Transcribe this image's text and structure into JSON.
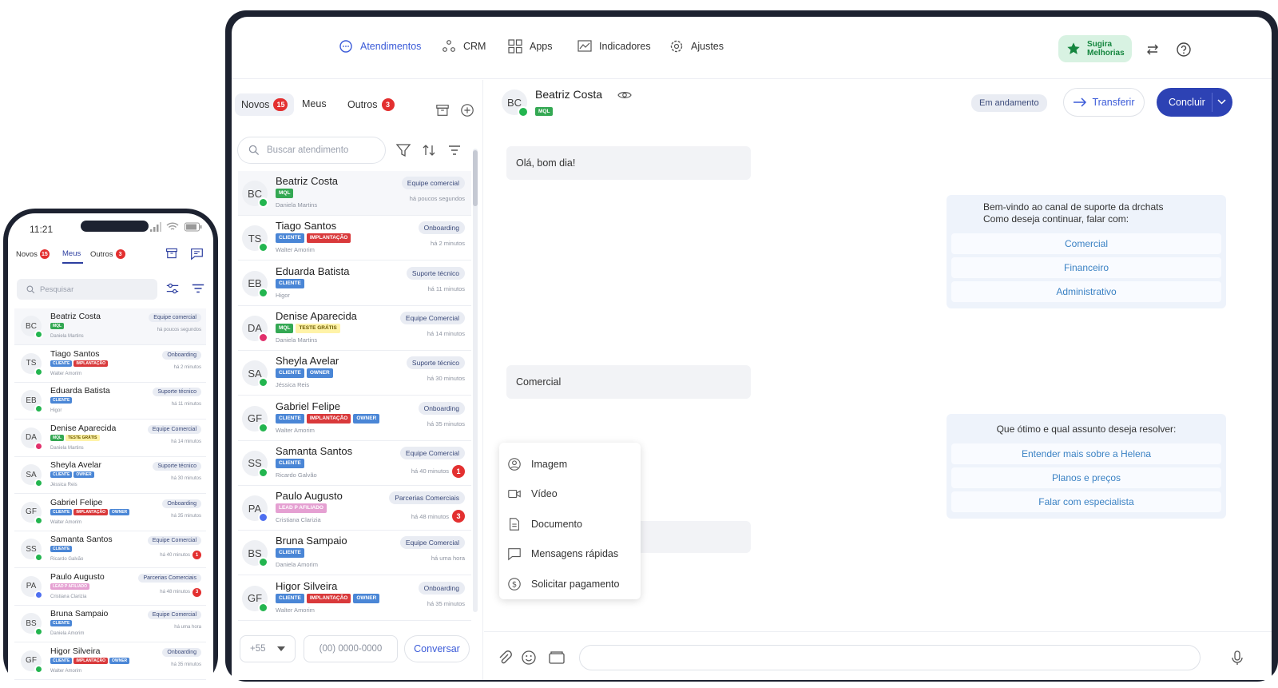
{
  "desktop": {
    "nav": [
      {
        "label": "Atendimentos",
        "icon": "chat-bubble-icon"
      },
      {
        "label": "CRM",
        "icon": "crm-nodes-icon"
      },
      {
        "label": "Apps",
        "icon": "apps-grid-icon"
      },
      {
        "label": "Indicadores",
        "icon": "chart-icon"
      },
      {
        "label": "Ajustes",
        "icon": "gear-icon"
      }
    ],
    "suggest_label": "Sugira Melhorias",
    "tabs": {
      "novos": "Novos",
      "novos_count": "15",
      "meus": "Meus",
      "outros": "Outros",
      "outros_count": "3"
    },
    "search_placeholder": "Buscar atendimento",
    "conversations": [
      {
        "initials": "BC",
        "name": "Beatriz Costa",
        "tags": [
          {
            "t": "MQL",
            "c": "mql"
          }
        ],
        "agent": "Daniela Martins",
        "team": "Equipe comercial",
        "time": "há poucos segundos",
        "badge": "",
        "channel": "whatsapp"
      },
      {
        "initials": "TS",
        "name": "Tiago Santos",
        "tags": [
          {
            "t": "CLIENTE",
            "c": "cliente"
          },
          {
            "t": "IMPLANTAÇÃO",
            "c": "impl"
          }
        ],
        "agent": "Walter Amorim",
        "team": "Onboarding",
        "time": "há 2 minutos",
        "badge": "",
        "channel": "whatsapp"
      },
      {
        "initials": "EB",
        "name": "Eduarda Batista",
        "tags": [
          {
            "t": "CLIENTE",
            "c": "cliente"
          }
        ],
        "agent": "Higor",
        "team": "Suporte técnico",
        "time": "há 11 minutos",
        "badge": "",
        "channel": "whatsapp"
      },
      {
        "initials": "DA",
        "name": "Denise Aparecida",
        "tags": [
          {
            "t": "MQL",
            "c": "mql"
          },
          {
            "t": "TESTE GRÁTIS",
            "c": "teste"
          }
        ],
        "agent": "Daniela Martins",
        "team": "Equipe Comercial",
        "time": "há 14 minutos",
        "badge": "",
        "channel": "instagram"
      },
      {
        "initials": "SA",
        "name": "Sheyla Avelar",
        "tags": [
          {
            "t": "CLIENTE",
            "c": "cliente"
          },
          {
            "t": "OWNER",
            "c": "owner"
          }
        ],
        "agent": "Jéssica Reis",
        "team": "Suporte técnico",
        "time": "há 30 minutos",
        "badge": "",
        "channel": "whatsapp"
      },
      {
        "initials": "GF",
        "name": "Gabriel Felipe",
        "tags": [
          {
            "t": "CLIENTE",
            "c": "cliente"
          },
          {
            "t": "IMPLANTAÇÃO",
            "c": "impl"
          },
          {
            "t": "OWNER",
            "c": "owner"
          }
        ],
        "agent": "Walter Amorim",
        "team": "Onboarding",
        "time": "há 35 minutos",
        "badge": "",
        "channel": "whatsapp"
      },
      {
        "initials": "SS",
        "name": "Samanta Santos",
        "tags": [
          {
            "t": "CLIENTE",
            "c": "cliente"
          }
        ],
        "agent": "Ricardo Galvão",
        "team": "Equipe Comercial",
        "time": "há 40 minutos",
        "badge": "1",
        "channel": "whatsapp"
      },
      {
        "initials": "PA",
        "name": "Paulo Augusto",
        "tags": [
          {
            "t": "LEAD P AFILIADO",
            "c": "lead"
          }
        ],
        "agent": "Cristiana Clarizia",
        "team": "Parcerias Comerciais",
        "time": "há 48 minutos",
        "badge": "3",
        "channel": "messenger"
      },
      {
        "initials": "BS",
        "name": "Bruna Sampaio",
        "tags": [
          {
            "t": "CLIENTE",
            "c": "cliente"
          }
        ],
        "agent": "Daniela Amorim",
        "team": "Equipe Comercial",
        "time": "há uma hora",
        "badge": "",
        "channel": "whatsapp"
      },
      {
        "initials": "GF",
        "name": "Higor Silveira",
        "tags": [
          {
            "t": "CLIENTE",
            "c": "cliente"
          },
          {
            "t": "IMPLANTAÇÃO",
            "c": "impl"
          },
          {
            "t": "OWNER",
            "c": "owner"
          }
        ],
        "agent": "Walter Amorim",
        "team": "Onboarding",
        "time": "há 35 minutos",
        "badge": "",
        "channel": "whatsapp"
      }
    ],
    "ddd_value": "+55",
    "phone_placeholder": "(00) 0000-0000",
    "conversar_label": "Conversar",
    "chat": {
      "initials": "BC",
      "name": "Beatriz Costa",
      "tag": "MQL",
      "status": "Em andamento",
      "transfer_label": "Transferir",
      "conclude_label": "Concluir",
      "messages": {
        "m1": "Olá, bom dia!",
        "bot1_line1": "Bem-vindo ao canal de suporte da  drchats",
        "bot1_line2": "Como deseja continuar, falar com:",
        "bot1_options": [
          "Comercial",
          "Financeiro",
          "Administrativo"
        ],
        "m2": "Comercial",
        "bot2_line1": "Que ótimo e qual assunto deseja resolver:",
        "bot2_options": [
          "Entender mais sobre a Helena",
          "Planos e preços",
          "Falar com especialista"
        ]
      },
      "attach_menu": [
        {
          "label": "Imagem",
          "icon": "image-user-icon"
        },
        {
          "label": "Vídeo",
          "icon": "video-icon"
        },
        {
          "label": "Documento",
          "icon": "document-icon"
        },
        {
          "label": "Mensagens rápidas",
          "icon": "quick-message-icon"
        },
        {
          "label": "Solicitar pagamento",
          "icon": "dollar-icon"
        }
      ]
    }
  },
  "mobile": {
    "time": "11:21",
    "tabs": {
      "novos": "Novos",
      "novos_count": "15",
      "meus": "Meus",
      "outros": "Outros",
      "outros_count": "3"
    },
    "search_placeholder": "Pesquisar",
    "conversations": [
      {
        "initials": "BC",
        "name": "Beatriz Costa",
        "tags": [
          {
            "t": "MQL",
            "c": "mql"
          }
        ],
        "agent": "Daniela Martins",
        "team": "Equipe comercial",
        "time": "há poucos segundos",
        "badge": "",
        "channel": "whatsapp"
      },
      {
        "initials": "TS",
        "name": "Tiago Santos",
        "tags": [
          {
            "t": "CLIENTE",
            "c": "cliente"
          },
          {
            "t": "IMPLANTAÇÃO",
            "c": "impl"
          }
        ],
        "agent": "Walter Amorim",
        "team": "Onboarding",
        "time": "há 2 minutos",
        "badge": "",
        "channel": "whatsapp"
      },
      {
        "initials": "EB",
        "name": "Eduarda Batista",
        "tags": [
          {
            "t": "CLIENTE",
            "c": "cliente"
          }
        ],
        "agent": "Higor",
        "team": "Suporte técnico",
        "time": "há 11 minutos",
        "badge": "",
        "channel": "whatsapp"
      },
      {
        "initials": "DA",
        "name": "Denise Aparecida",
        "tags": [
          {
            "t": "MQL",
            "c": "mql"
          },
          {
            "t": "TESTE GRÁTIS",
            "c": "teste"
          }
        ],
        "agent": "Daniela Martins",
        "team": "Equipe Comercial",
        "time": "há 14 minutos",
        "badge": "",
        "channel": "instagram"
      },
      {
        "initials": "SA",
        "name": "Sheyla Avelar",
        "tags": [
          {
            "t": "CLIENTE",
            "c": "cliente"
          },
          {
            "t": "OWNER",
            "c": "owner"
          }
        ],
        "agent": "Jéssica Reis",
        "team": "Suporte técnico",
        "time": "há 30 minutos",
        "badge": "",
        "channel": "whatsapp"
      },
      {
        "initials": "GF",
        "name": "Gabriel Felipe",
        "tags": [
          {
            "t": "CLIENTE",
            "c": "cliente"
          },
          {
            "t": "IMPLANTAÇÃO",
            "c": "impl"
          },
          {
            "t": "OWNER",
            "c": "owner"
          }
        ],
        "agent": "Walter Amorim",
        "team": "Onboarding",
        "time": "há 35 minutos",
        "badge": "",
        "channel": "whatsapp"
      },
      {
        "initials": "SS",
        "name": "Samanta Santos",
        "tags": [
          {
            "t": "CLIENTE",
            "c": "cliente"
          }
        ],
        "agent": "Ricardo Galvão",
        "team": "Equipe Comercial",
        "time": "há 40 minutos",
        "badge": "1",
        "channel": "whatsapp"
      },
      {
        "initials": "PA",
        "name": "Paulo Augusto",
        "tags": [
          {
            "t": "LEAD P AFILIADO",
            "c": "lead"
          }
        ],
        "agent": "Cristiana Clarizia",
        "team": "Parcerias Comerciais",
        "time": "há 48 minutos",
        "badge": "3",
        "channel": "messenger"
      },
      {
        "initials": "BS",
        "name": "Bruna Sampaio",
        "tags": [
          {
            "t": "CLIENTE",
            "c": "cliente"
          }
        ],
        "agent": "Daniela Amorim",
        "team": "Equipe Comercial",
        "time": "há uma hora",
        "badge": "",
        "channel": "whatsapp"
      },
      {
        "initials": "GF",
        "name": "Higor Silveira",
        "tags": [
          {
            "t": "CLIENTE",
            "c": "cliente"
          },
          {
            "t": "IMPLANTAÇÃO",
            "c": "impl"
          },
          {
            "t": "OWNER",
            "c": "owner"
          }
        ],
        "agent": "Walter Amorim",
        "team": "Onboarding",
        "time": "há 35 minutos",
        "badge": "",
        "channel": "whatsapp"
      }
    ]
  },
  "colors": {
    "accent": "#3b5bd8",
    "primary_button": "#2d42b4",
    "frame": "#1d2230",
    "suggest_bg": "#d8f2e2",
    "suggest_text": "#15863f",
    "badge": "#e33030"
  }
}
